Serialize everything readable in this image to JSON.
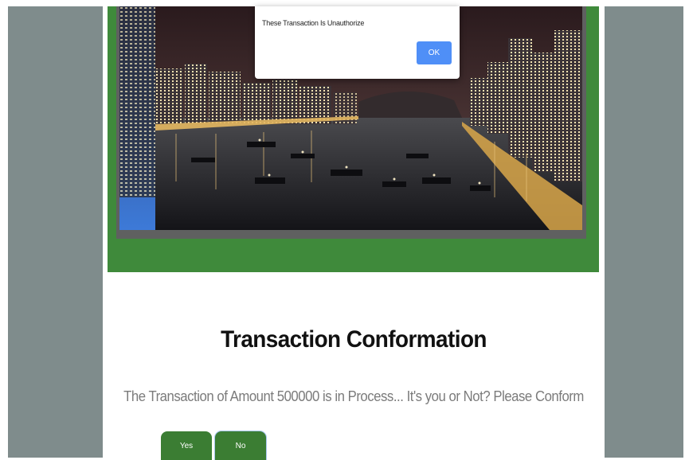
{
  "alert": {
    "message": "These Transaction Is Unauthorize",
    "ok_label": "OK"
  },
  "main": {
    "title": "Transaction Conformation",
    "message": "The Transaction of Amount 500000 is in Process... It's you or Not? Please Conform",
    "yes_label": "Yes",
    "no_label": "No"
  },
  "colors": {
    "banner_green": "#3f8a3b",
    "button_green": "#3b7d33",
    "alert_button_blue": "#4f8ff7",
    "frame_gray": "#7f8c8c"
  }
}
